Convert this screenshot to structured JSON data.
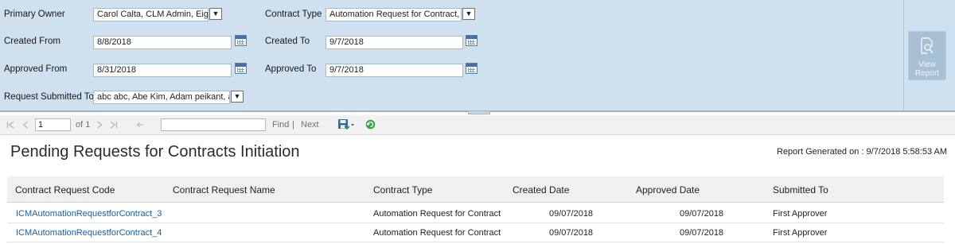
{
  "params": {
    "primary_owner_label": "Primary Owner",
    "primary_owner_value": "Carol Calta, CLM Admin, Eighth Approver",
    "contract_type_label": "Contract Type",
    "contract_type_value": "Automation Request for Contract, Amendment",
    "created_from_label": "Created From",
    "created_from_value": "8/8/2018",
    "created_to_label": "Created To",
    "created_to_value": "9/7/2018",
    "approved_from_label": "Approved From",
    "approved_from_value": "8/31/2018",
    "approved_to_label": "Approved To",
    "approved_to_value": "9/7/2018",
    "request_submitted_to_label": "Request Submitted To",
    "request_submitted_to_value": "abc abc, Abe Kim, Adam peikant, admin",
    "view_report_line1": "View",
    "view_report_line2": "Report"
  },
  "toolbar": {
    "page_value": "1",
    "page_of": "of 1",
    "find_label": "Find",
    "separator": "|",
    "next_label": "Next"
  },
  "report": {
    "title": "Pending Requests for Contracts Initiation",
    "generated": "Report Generated on : 9/7/2018 5:58:53 AM",
    "columns": [
      "Contract Request Code",
      "Contract Request Name",
      "Contract Type",
      "Created Date",
      "Approved Date",
      "Submitted To"
    ],
    "rows": [
      {
        "code": "ICMAutomationRequestforContract_3",
        "name": "",
        "type": "Automation Request for Contract",
        "created": "09/07/2018",
        "approved": "09/07/2018",
        "submitted": "First Approver"
      },
      {
        "code": "ICMAutomationRequestforContract_4",
        "name": "",
        "type": "Automation Request for Contract",
        "created": "09/07/2018",
        "approved": "09/07/2018",
        "submitted": "First Approver"
      }
    ]
  },
  "colors": {
    "panel_bg": "#cfe0ef",
    "link": "#1a5d9c",
    "header_bg": "#f0f0f0"
  }
}
